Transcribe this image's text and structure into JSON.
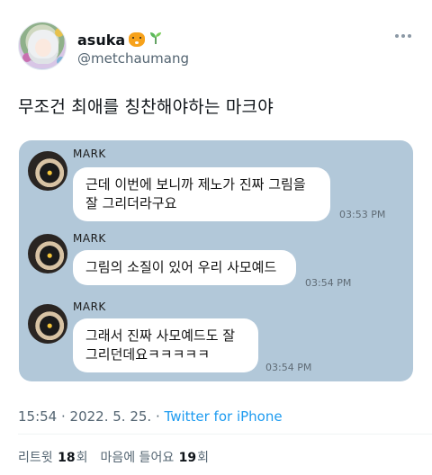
{
  "user": {
    "display_name": "asuka",
    "emoji_icons": [
      "tiger-icon",
      "sprout-icon"
    ],
    "handle": "@metchaumang"
  },
  "tweet": {
    "text": "무조건 최애를 칭찬해야하는 마크야"
  },
  "chat": {
    "background": "#b2c8d9",
    "messages": [
      {
        "sender": "MARK",
        "lines": [
          "근데 이번에 보니까 제노가 진짜 그림을",
          "잘 그리더라구요"
        ],
        "time": "03:53 PM"
      },
      {
        "sender": "MARK",
        "lines": [
          "그림의 소질이 있어 우리 사모예드"
        ],
        "time": "03:54 PM"
      },
      {
        "sender": "MARK",
        "lines": [
          "그래서 진짜 사모예드도 잘",
          "그리던데요ㅋㅋㅋㅋㅋ"
        ],
        "time": "03:54 PM"
      }
    ]
  },
  "meta": {
    "time": "15:54",
    "separator": " · ",
    "date": "2022. 5. 25.",
    "source": "Twitter for iPhone"
  },
  "stats": {
    "retweets_label": "리트윗",
    "retweets_count": "18",
    "retweets_unit": "회",
    "likes_label": "마음에 들어요",
    "likes_count": "19",
    "likes_unit": "회"
  },
  "colors": {
    "link": "#1d9bf0",
    "secondary_text": "#536471"
  }
}
